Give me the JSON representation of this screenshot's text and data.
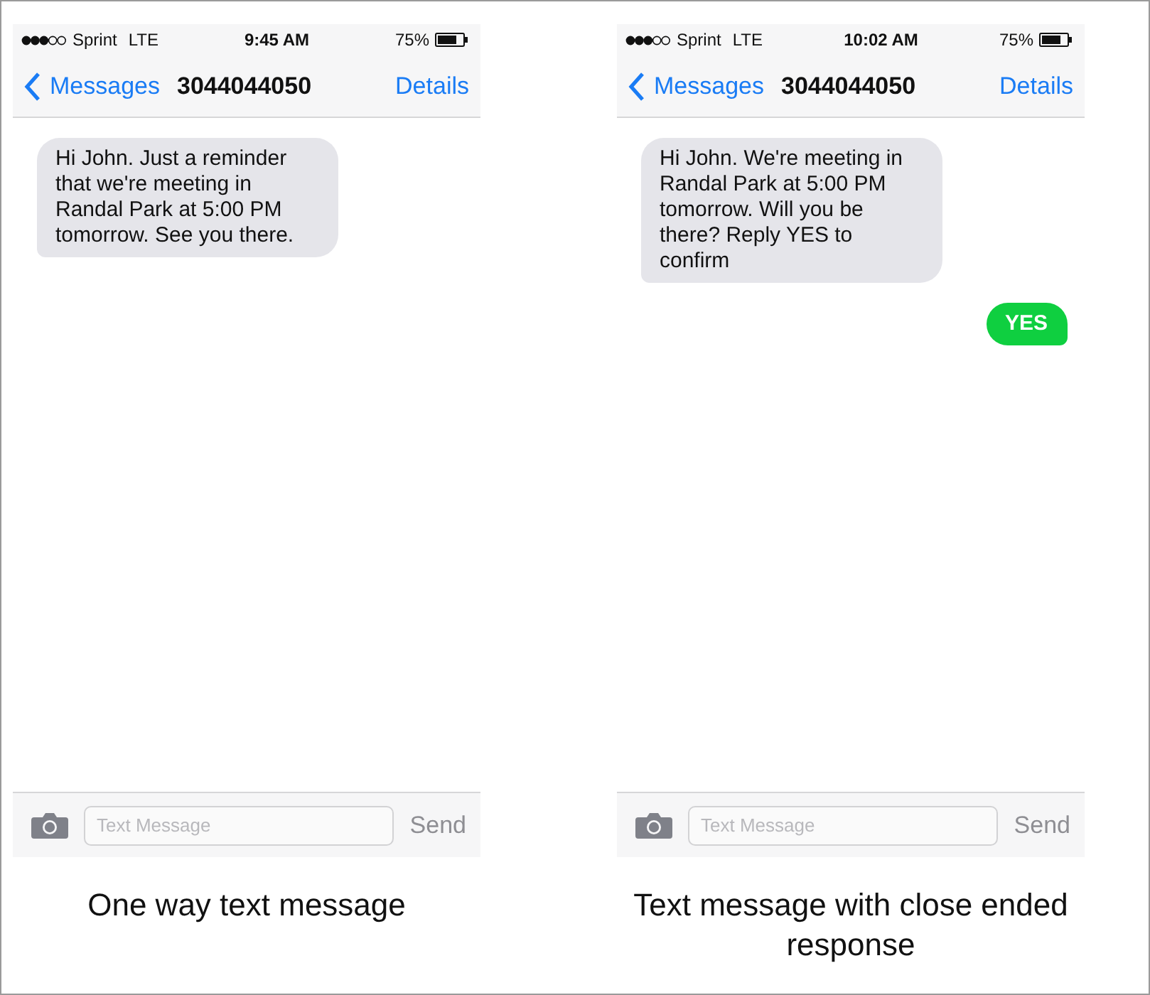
{
  "panels": [
    {
      "status_bar": {
        "carrier": "Sprint",
        "network": "LTE",
        "time": "9:45 AM",
        "battery": "75%"
      },
      "nav_bar": {
        "back": "Messages",
        "title": "3044044050",
        "action": "Details"
      },
      "messages": [
        {
          "kind": "incoming",
          "text": "Hi John. Just a reminder that we're meeting in Randal Park at 5:00 PM tomorrow. See you there."
        }
      ],
      "composer": {
        "placeholder": "Text Message",
        "send": "Send"
      },
      "caption": "One way text message"
    },
    {
      "status_bar": {
        "carrier": "Sprint",
        "network": "LTE",
        "time": "10:02 AM",
        "battery": "75%"
      },
      "nav_bar": {
        "back": "Messages",
        "title": "3044044050",
        "action": "Details"
      },
      "messages": [
        {
          "kind": "incoming",
          "text": "Hi John. We're meeting in Randal Park at 5:00 PM tomorrow. Will you be there? Reply YES to confirm"
        },
        {
          "kind": "outgoing",
          "text": "YES"
        }
      ],
      "composer": {
        "placeholder": "Text Message",
        "send": "Send"
      },
      "caption": "Text message with close ended response"
    }
  ]
}
